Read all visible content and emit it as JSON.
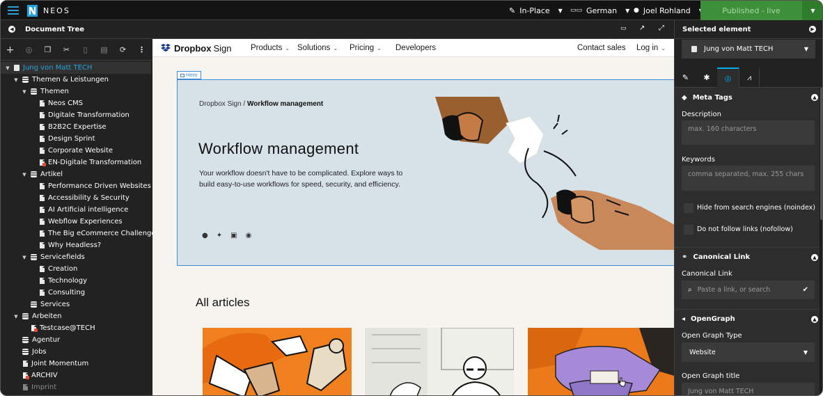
{
  "topbar": {
    "brand": "NEOS",
    "edit_mode": "In-Place",
    "language": "German",
    "user": "Joel Rohland",
    "publish_status": "Published - live"
  },
  "document_tree": {
    "title": "Document Tree",
    "nodes": [
      {
        "label": "Jung von Matt TECH"
      },
      {
        "label": "Themen & Leistungen"
      },
      {
        "label": "Themen"
      },
      {
        "label": "Neos CMS"
      },
      {
        "label": "Digitale Transformation"
      },
      {
        "label": "B2B2C Expertise"
      },
      {
        "label": "Design Sprint"
      },
      {
        "label": "Corporate Website"
      },
      {
        "label": "EN-Digitale Transformation"
      },
      {
        "label": "Artikel"
      },
      {
        "label": "Performance Driven Websites"
      },
      {
        "label": "Accessibility & Security"
      },
      {
        "label": "AI Artificial intelligence"
      },
      {
        "label": "Webflow Experiences"
      },
      {
        "label": "The Big eCommerce Challenge"
      },
      {
        "label": "Why Headless?"
      },
      {
        "label": "Servicefields"
      },
      {
        "label": "Creation"
      },
      {
        "label": "Technology"
      },
      {
        "label": "Consulting"
      },
      {
        "label": "Services"
      },
      {
        "label": "Arbeiten"
      },
      {
        "label": "Testcase@TECH"
      },
      {
        "label": "Agentur"
      },
      {
        "label": "Jobs"
      },
      {
        "label": "Joint Momentum"
      },
      {
        "label": "ARCHIV"
      },
      {
        "label": "Imprint"
      }
    ]
  },
  "site": {
    "logo_main": "Dropbox",
    "logo_sub": "Sign",
    "nav": [
      "Products",
      "Solutions",
      "Pricing",
      "Developers"
    ],
    "contact": "Contact sales",
    "login": "Log in",
    "hero_tag": "Hero",
    "breadcrumb_root": "Dropbox Sign",
    "breadcrumb_sep": "/",
    "breadcrumb_current": "Workflow management",
    "hero_title": "Workflow management",
    "hero_text": "Your workflow doesn't have to be complicated. Explore ways to build easy-to-use workflows for speed, security, and efficiency.",
    "articles_heading": "All articles"
  },
  "inspector": {
    "title": "Selected element",
    "selected_node": "Jung von Matt TECH",
    "meta": {
      "section": "Meta Tags",
      "description_label": "Description",
      "description_placeholder": "max. 160 characters",
      "keywords_label": "Keywords",
      "keywords_placeholder": "comma separated, max. 255 chars",
      "noindex_label": "Hide from search engines (noindex)",
      "nofollow_label": "Do not follow links (nofollow)"
    },
    "canonical": {
      "section": "Canonical Link",
      "label": "Canonical Link",
      "placeholder": "Paste a link, or search"
    },
    "opengraph": {
      "section": "OpenGraph",
      "type_label": "Open Graph Type",
      "type_value": "Website",
      "title_label": "Open Graph title",
      "title_placeholder": "Jung von Matt TECH"
    }
  },
  "colors": {
    "publish_green": "#3d8f3a",
    "accent_blue": "#00adee",
    "canvas_highlight": "#3d8bd8"
  }
}
